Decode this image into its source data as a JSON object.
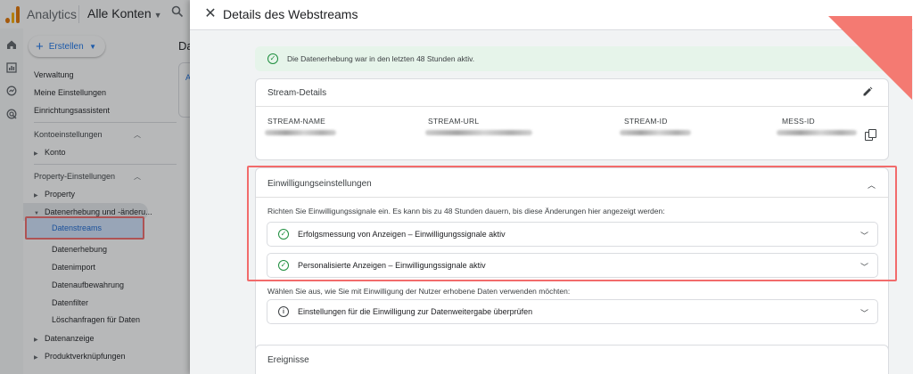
{
  "app": {
    "name": "Analytics",
    "account": "Alle Konten",
    "main_title_partial": "Da",
    "main_link_partial": "A"
  },
  "nav": {
    "create_label": "Erstellen",
    "items": [
      "Verwaltung",
      "Meine Einstellungen",
      "Einrichtungsassistent"
    ],
    "account_settings_head": "Kontoeinstellungen",
    "konto": "Konto",
    "property_settings_head": "Property-Einstellungen",
    "property": "Property",
    "data_collection": "Datenerhebung und -änderu...",
    "sub_items": [
      "Datenstreams",
      "Datenerhebung",
      "Datenimport",
      "Datenaufbewahrung",
      "Datenfilter",
      "Löschanfragen für Daten"
    ],
    "data_display": "Datenanzeige",
    "product_links": "Produktverknüpfungen"
  },
  "panel": {
    "title": "Details des Webstreams",
    "success_msg": "Die Datenerhebung war in den letzten 48 Stunden aktiv.",
    "stream_details": {
      "title": "Stream-Details",
      "fields": [
        "STREAM-NAME",
        "STREAM-URL",
        "STREAM-ID",
        "MESS-ID"
      ]
    },
    "consent": {
      "title": "Einwilligungseinstellungen",
      "description": "Richten Sie Einwilligungssignale ein. Es kann bis zu 48 Stunden dauern, bis diese Änderungen hier angezeigt werden:",
      "rows": [
        "Erfolgsmessung von Anzeigen – Einwilligungssignale aktiv",
        "Personalisierte Anzeigen – Einwilligungssignale aktiv"
      ],
      "usage_description": "Wählen Sie aus, wie Sie mit Einwilligung der Nutzer erhobene Daten verwenden möchten:",
      "review_row": "Einstellungen für die Einwilligung zur Datenweitergabe überprüfen"
    },
    "events_title": "Ereignisse"
  },
  "colors": {
    "accent": "#1a73e8",
    "success": "#1e8e3e",
    "highlight": "#f26b6b"
  }
}
